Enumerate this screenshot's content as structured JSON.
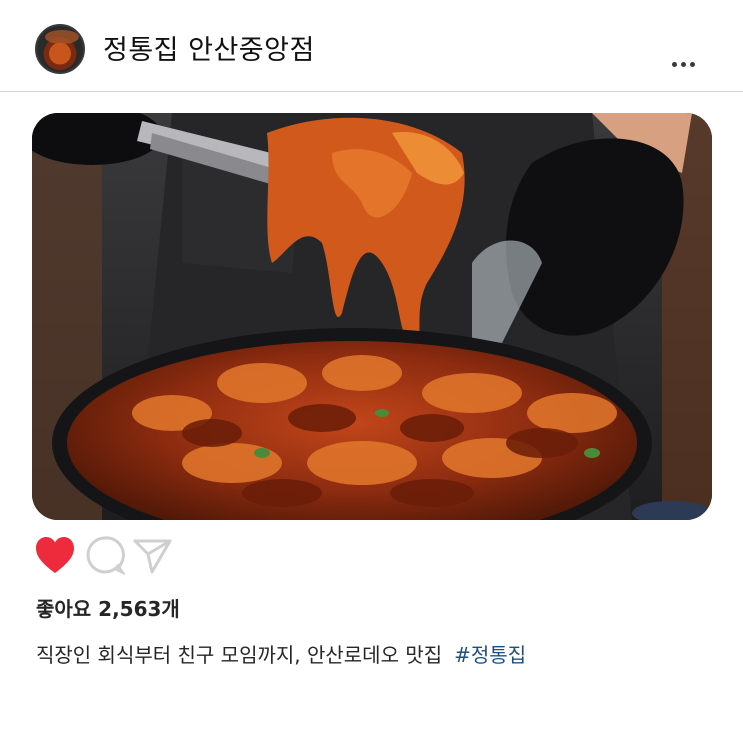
{
  "post": {
    "account_name": "정통집 안산중앙점",
    "more_icon": "more-horizontal-icon",
    "media": {
      "kind": "photo",
      "depicts": "spicy stir-fried pork and kimchi in a pan lifted with tongs by black-gloved hands"
    },
    "actions": {
      "like_icon": "heart-filled-icon",
      "comment_icon": "comment-bubble-icon",
      "share_icon": "paper-plane-icon",
      "liked": true,
      "like_color": "#ed2b3c"
    },
    "likes_text": "좋아요 2,563개",
    "caption": {
      "text": "직장인 회식부터 친구 모임까지, 안산로데오 맛집",
      "hashtag": "#정통집",
      "hashtag_color": "#1f4f82"
    }
  }
}
